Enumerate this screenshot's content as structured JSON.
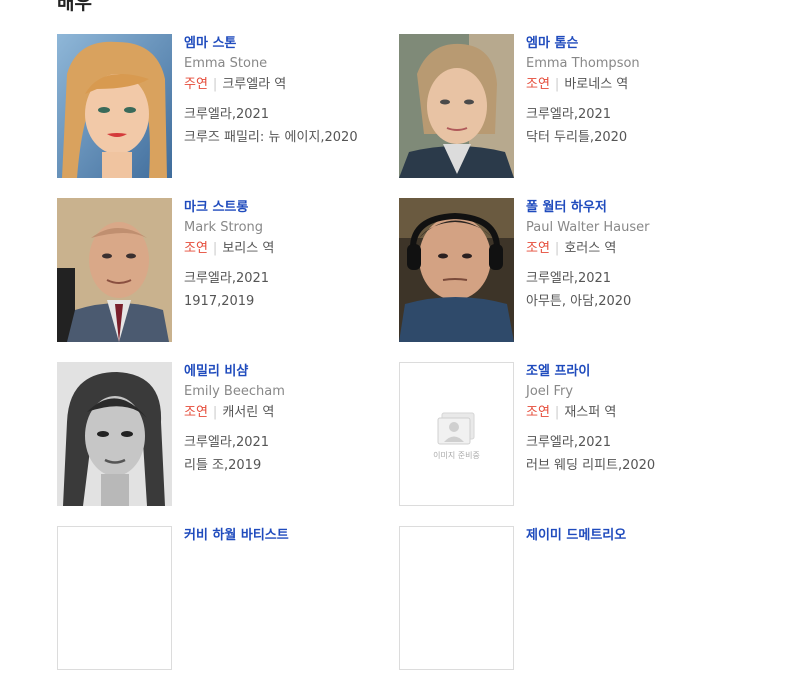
{
  "section": {
    "title": "배우"
  },
  "actors": [
    {
      "name_ko": "엠마 스톤",
      "name_en": "Emma Stone",
      "role_type": "주연",
      "role": "크루엘라 역",
      "works": [
        "크루엘라,2021",
        "크루즈 패밀리: 뉴 에이지,2020"
      ]
    },
    {
      "name_ko": "엠마 톰슨",
      "name_en": "Emma Thompson",
      "role_type": "조연",
      "role": "바로네스 역",
      "works": [
        "크루엘라,2021",
        "닥터 두리틀,2020"
      ]
    },
    {
      "name_ko": "마크 스트롱",
      "name_en": "Mark Strong",
      "role_type": "조연",
      "role": "보리스 역",
      "works": [
        "크루엘라,2021",
        "1917,2019"
      ]
    },
    {
      "name_ko": "폴 월터 하우저",
      "name_en": "Paul Walter Hauser",
      "role_type": "조연",
      "role": "호러스 역",
      "works": [
        "크루엘라,2021",
        "아무튼, 아담,2020"
      ]
    },
    {
      "name_ko": "에밀리 비샴",
      "name_en": "Emily Beecham",
      "role_type": "조연",
      "role": "캐서린 역",
      "works": [
        "크루엘라,2021",
        "리틀 조,2019"
      ]
    },
    {
      "name_ko": "조엘 프라이",
      "name_en": "Joel Fry",
      "role_type": "조연",
      "role": "재스퍼 역",
      "works": [
        "크루엘라,2021",
        "러브 웨딩 리피트,2020"
      ],
      "placeholder_text": "이미지 준비중"
    },
    {
      "name_ko": "커비 하월 바티스트"
    },
    {
      "name_ko": "제이미 드메트리오"
    }
  ],
  "colors": {
    "name": "#1f4bbd",
    "role_type": "#e54b39",
    "muted": "#888888"
  }
}
